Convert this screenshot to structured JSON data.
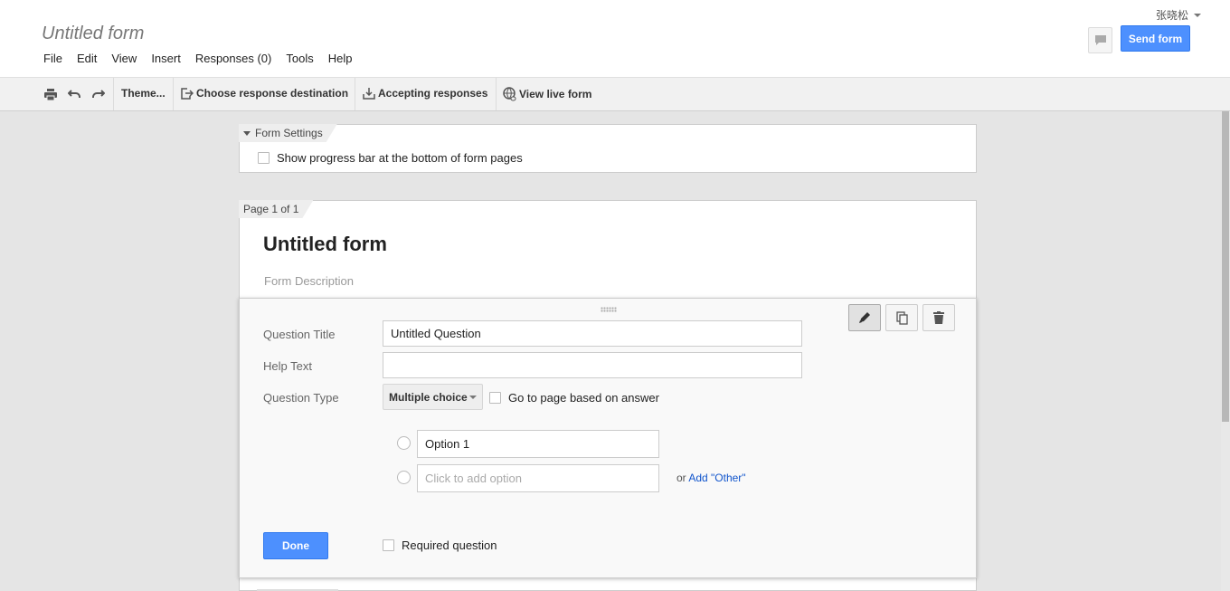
{
  "header": {
    "doc_title": "Untitled form",
    "user_name": "张晓松",
    "send_label": "Send form",
    "menu": [
      "File",
      "Edit",
      "View",
      "Insert",
      "Responses (0)",
      "Tools",
      "Help"
    ]
  },
  "toolbar": {
    "theme_label": "Theme...",
    "destination_label": "Choose response destination",
    "accepting_label": "Accepting responses",
    "live_label": "View live form"
  },
  "form_settings": {
    "label": "Form Settings",
    "progress_label": "Show progress bar at the bottom of form pages",
    "progress_checked": false
  },
  "page": {
    "label": "Page 1 of 1",
    "title": "Untitled form",
    "description_placeholder": "Form Description"
  },
  "question": {
    "title_label": "Question Title",
    "title_value": "Untitled Question",
    "help_label": "Help Text",
    "help_value": "",
    "type_label": "Question Type",
    "type_value": "Multiple choice",
    "goto_label": "Go to page based on answer",
    "options": [
      "Option 1"
    ],
    "add_option_placeholder": "Click to add option",
    "or_label": "or",
    "add_other_label": "Add \"Other\"",
    "done_label": "Done",
    "required_label": "Required question"
  },
  "colors": {
    "accent": "#4d90fe",
    "link": "#1155cc"
  }
}
